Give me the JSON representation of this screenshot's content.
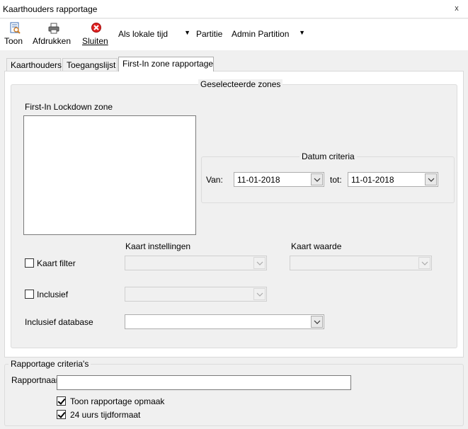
{
  "window": {
    "title": "Kaarthouders rapportage",
    "close_glyph": "x"
  },
  "toolbar": {
    "buttons": [
      {
        "label": "Toon",
        "icon": "report-view-icon"
      },
      {
        "label": "Afdrukken",
        "icon": "printer-icon"
      },
      {
        "label": "Sluiten",
        "icon": "close-circle-icon",
        "color": "#e02020"
      }
    ],
    "time_mode": "Als lokale tijd",
    "partition_label": "Partitie",
    "partition_value": "Admin Partition"
  },
  "tabs": [
    {
      "label": "Kaarthouders",
      "active": false
    },
    {
      "label": "Toegangslijst",
      "active": false
    },
    {
      "label": "First-In zone rapportage",
      "active": true
    }
  ],
  "zones": {
    "legend": "Geselecteerde zones",
    "list_label": "First-In Lockdown zone",
    "datum": {
      "legend": "Datum criteria",
      "from_label": "Van:",
      "from_value": "11-01-2018",
      "to_label": "tot:",
      "to_value": "11-01-2018"
    },
    "kaart_instellingen_label": "Kaart instellingen",
    "kaart_waarde_label": "Kaart waarde",
    "kaart_filter_label": "Kaart filter",
    "kaart_filter_checked": false,
    "inclusief_label": "Inclusief",
    "inclusief_checked": false,
    "inclusief_database_label": "Inclusief database"
  },
  "criteria": {
    "legend": "Rapportage criteria's",
    "rapportnaam_label": "Rapportnaam",
    "rapportnaam_value": "",
    "toon_opmaak_label": "Toon rapportage opmaak",
    "toon_opmaak_checked": true,
    "tijdformaat_label": "24 uurs tijdformaat",
    "tijdformaat_checked": true
  }
}
